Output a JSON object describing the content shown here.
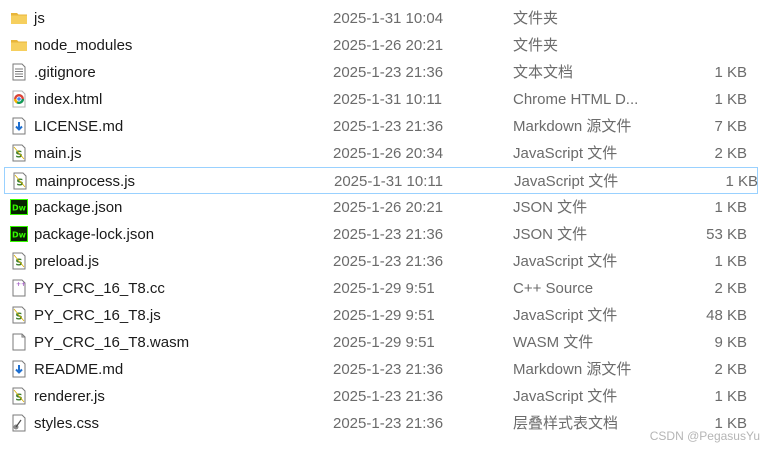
{
  "files": [
    {
      "name": "js",
      "date": "2025-1-31 10:04",
      "type": "文件夹",
      "size": "",
      "icon": "folder-icon"
    },
    {
      "name": "node_modules",
      "date": "2025-1-26 20:21",
      "type": "文件夹",
      "size": "",
      "icon": "folder-icon"
    },
    {
      "name": ".gitignore",
      "date": "2025-1-23 21:36",
      "type": "文本文档",
      "size": "1 KB",
      "icon": "text-document-icon"
    },
    {
      "name": "index.html",
      "date": "2025-1-31 10:11",
      "type": "Chrome HTML D...",
      "size": "1 KB",
      "icon": "chrome-html-icon"
    },
    {
      "name": "LICENSE.md",
      "date": "2025-1-23 21:36",
      "type": "Markdown 源文件",
      "size": "7 KB",
      "icon": "markdown-file-icon"
    },
    {
      "name": "main.js",
      "date": "2025-1-26 20:34",
      "type": "JavaScript 文件",
      "size": "2 KB",
      "icon": "javascript-file-icon"
    },
    {
      "name": "mainprocess.js",
      "date": "2025-1-31 10:11",
      "type": "JavaScript 文件",
      "size": "1 KB",
      "icon": "javascript-file-icon"
    },
    {
      "name": "package.json",
      "date": "2025-1-26 20:21",
      "type": "JSON 文件",
      "size": "1 KB",
      "icon": "dreamweaver-json-icon"
    },
    {
      "name": "package-lock.json",
      "date": "2025-1-23 21:36",
      "type": "JSON 文件",
      "size": "53 KB",
      "icon": "dreamweaver-json-icon"
    },
    {
      "name": "preload.js",
      "date": "2025-1-23 21:36",
      "type": "JavaScript 文件",
      "size": "1 KB",
      "icon": "javascript-file-icon"
    },
    {
      "name": "PY_CRC_16_T8.cc",
      "date": "2025-1-29 9:51",
      "type": "C++ Source",
      "size": "2 KB",
      "icon": "cpp-source-icon"
    },
    {
      "name": "PY_CRC_16_T8.js",
      "date": "2025-1-29 9:51",
      "type": "JavaScript 文件",
      "size": "48 KB",
      "icon": "javascript-file-icon"
    },
    {
      "name": "PY_CRC_16_T8.wasm",
      "date": "2025-1-29 9:51",
      "type": "WASM 文件",
      "size": "9 KB",
      "icon": "blank-file-icon"
    },
    {
      "name": "README.md",
      "date": "2025-1-23 21:36",
      "type": "Markdown 源文件",
      "size": "2 KB",
      "icon": "markdown-file-icon"
    },
    {
      "name": "renderer.js",
      "date": "2025-1-23 21:36",
      "type": "JavaScript 文件",
      "size": "1 KB",
      "icon": "javascript-file-icon"
    },
    {
      "name": "styles.css",
      "date": "2025-1-23 21:36",
      "type": "层叠样式表文档",
      "size": "1 KB",
      "icon": "css-file-icon"
    }
  ],
  "selected_index": 6,
  "watermark": "CSDN @PegasusYu",
  "colors": {
    "selection_border": "#99d1ff",
    "folder": "#f3c44c",
    "dreamweaver": "#35fa00"
  }
}
